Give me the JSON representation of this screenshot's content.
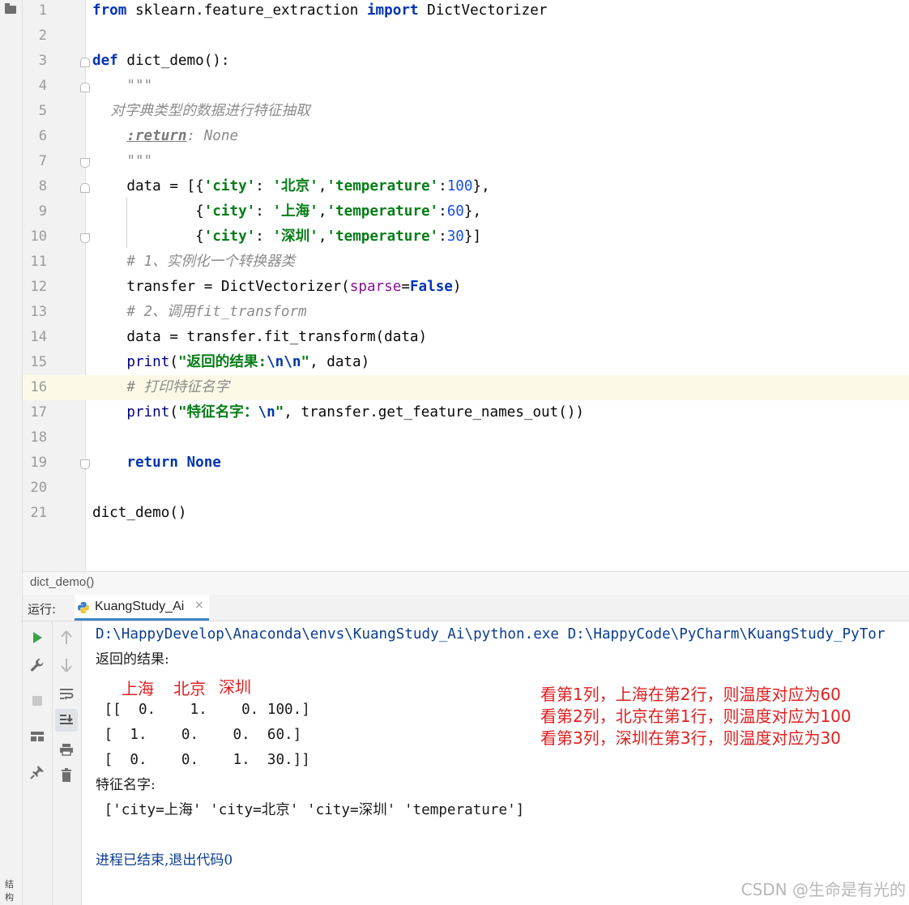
{
  "editor": {
    "line_numbers": [
      "1",
      "2",
      "3",
      "4",
      "5",
      "6",
      "7",
      "8",
      "9",
      "10",
      "11",
      "12",
      "13",
      "14",
      "15",
      "16",
      "17",
      "18",
      "19",
      "20",
      "21"
    ],
    "line1": {
      "kw_from": "from",
      "module": " sklearn.feature_extraction ",
      "kw_import": "import",
      "name": " DictVectorizer"
    },
    "line3": {
      "kw_def": "def",
      "sig": " dict_demo():"
    },
    "line4": {
      "doc": "    \"\"\""
    },
    "line5": {
      "doc": "    对字典类型的数据进行特征抽取"
    },
    "line6": {
      "indent": "    ",
      "tag": ":return",
      "rest": ": None"
    },
    "line7": {
      "doc": "    \"\"\""
    },
    "line8": {
      "pre": "    data = [{",
      "s1": "'city'",
      "p1": ": ",
      "s2": "'北京'",
      "p2": ",",
      "s3": "'temperature'",
      "p3": ":",
      "n": "100",
      "post": "},"
    },
    "line9": {
      "pre": "            {",
      "s1": "'city'",
      "p1": ": ",
      "s2": "'上海'",
      "p2": ",",
      "s3": "'temperature'",
      "p3": ":",
      "n": "60",
      "post": "},"
    },
    "line10": {
      "pre": "            {",
      "s1": "'city'",
      "p1": ": ",
      "s2": "'深圳'",
      "p2": ",",
      "s3": "'temperature'",
      "p3": ":",
      "n": "30",
      "post": "}]"
    },
    "line11": {
      "cm": "    # 1、实例化一个转换器类"
    },
    "line12": {
      "pre": "    transfer = DictVectorizer(",
      "param": "sparse",
      "eq": "=",
      "kw": "False",
      "post": ")"
    },
    "line13": {
      "cm": "    # 2、调用fit_transform"
    },
    "line14": {
      "text": "    data = transfer.fit_transform(data)"
    },
    "line15": {
      "indent": "    ",
      "bi": "print",
      "open": "(",
      "s": "\"返回的结果:",
      "esc": "\\n\\n",
      "close_s": "\"",
      "post": ", data)"
    },
    "line16": {
      "cm": "    # 打印特征名字"
    },
    "line17": {
      "indent": "    ",
      "bi": "print",
      "open": "(",
      "s": "\"特征名字：",
      "esc": "\\n",
      "close_s": "\"",
      "post": ", transfer.get_feature_names_out())"
    },
    "line19": {
      "indent": "    ",
      "kw1": "return",
      "sp": " ",
      "kw2": "None"
    },
    "line21": {
      "text": "dict_demo()"
    }
  },
  "breadcrumb": {
    "text": "dict_demo()"
  },
  "run_panel": {
    "label": "运行:",
    "tab_label": "KuangStudy_Ai",
    "tab_close": "×"
  },
  "console": {
    "cmd": "D:\\HappyDevelop\\Anaconda\\envs\\KuangStudy_Ai\\python.exe D:\\HappyCode\\PyCharm\\KuangStudy_PyTor",
    "result_label": "返回的结果:",
    "matrix": [
      " [[  0.    1.    0. 100.]",
      " [  1.    0.    0.  60.]",
      " [  0.    0.    1.  30.]]"
    ],
    "feature_label": "特征名字:",
    "feature_names": " ['city=上海' 'city=北京' 'city=深圳' 'temperature']",
    "exit": "进程已结束,退出代码0"
  },
  "annotations": {
    "col_headers": [
      "上海",
      "北京",
      "深圳"
    ],
    "notes": [
      "看第1列，上海在第2行，则温度对应为60",
      "看第2列，北京在第1行，则温度对应为100",
      "看第3列，深圳在第3行，则温度对应为30"
    ]
  },
  "watermark": "CSDN @生命是有光的",
  "left_strip_label": "结构",
  "colors": {
    "keyword": "#0033b3",
    "string": "#067d17",
    "number": "#1750eb",
    "comment": "#8c8c8c",
    "annotation": "#e02020",
    "line_highlight": "#fcfae6",
    "run_tab_accent": "#4083c9"
  }
}
